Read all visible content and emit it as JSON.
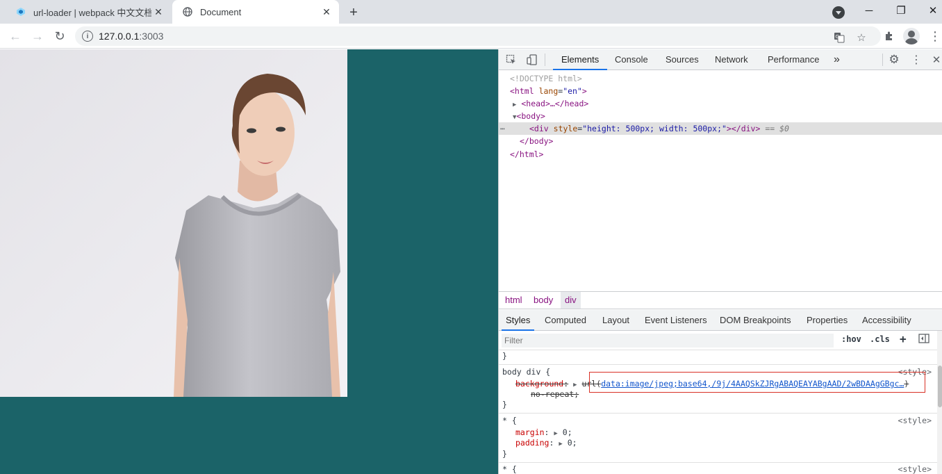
{
  "browser": {
    "tabs": [
      {
        "title": "url-loader | webpack 中文文档",
        "active": false,
        "favicon": "webpack-icon"
      },
      {
        "title": "Document",
        "active": true,
        "favicon": "globe-icon"
      }
    ],
    "new_tab_label": "+",
    "url_host": "127.0.0.1",
    "url_port": ":3003"
  },
  "page": {
    "background_color": "#1b6368",
    "image_alt": "woman in grey t-shirt"
  },
  "devtools": {
    "tabs": [
      "Elements",
      "Console",
      "Sources",
      "Network",
      "Performance"
    ],
    "more_tabs": "»",
    "dom": {
      "doctype": "<!DOCTYPE html>",
      "html_open": "<html",
      "html_attr": "lang",
      "html_val": "\"en\"",
      "head": "<head>…</head>",
      "body_open": "<body>",
      "div_tag": "<div",
      "div_attr": "style",
      "div_val": "\"height: 500px; width: 500px;\"",
      "div_close": "></div>",
      "div_ref": "== $0",
      "body_close": "</body>",
      "html_close": "</html>",
      "ellipsis": "⋯"
    },
    "breadcrumbs": [
      "html",
      "body",
      "div"
    ],
    "sub_tabs": [
      "Styles",
      "Computed",
      "Layout",
      "Event Listeners",
      "DOM Breakpoints",
      "Properties",
      "Accessibility"
    ],
    "filter_placeholder": "Filter",
    "hov": ":hov",
    "cls": ".cls",
    "plus": "+",
    "styles": {
      "closing_brace": "}",
      "rule1_selector": "body div {",
      "rule1_source": "<style>",
      "rule1_prop": "background",
      "rule1_fn": "url(",
      "rule1_link": "data:image/jpeg;base64,/9j/4AAQSkZJRgABAQEAYABgAAD/2wBDAAgGBgc…",
      "rule1_paren": ")",
      "rule1_cont": "no-repeat;",
      "rule2_selector": "* {",
      "rule2_source": "<style>",
      "margin_prop": "margin",
      "margin_val": "0;",
      "padding_prop": "padding",
      "padding_val": "0;",
      "rule3_selector": "* {",
      "rule3_source": "<style>"
    }
  }
}
